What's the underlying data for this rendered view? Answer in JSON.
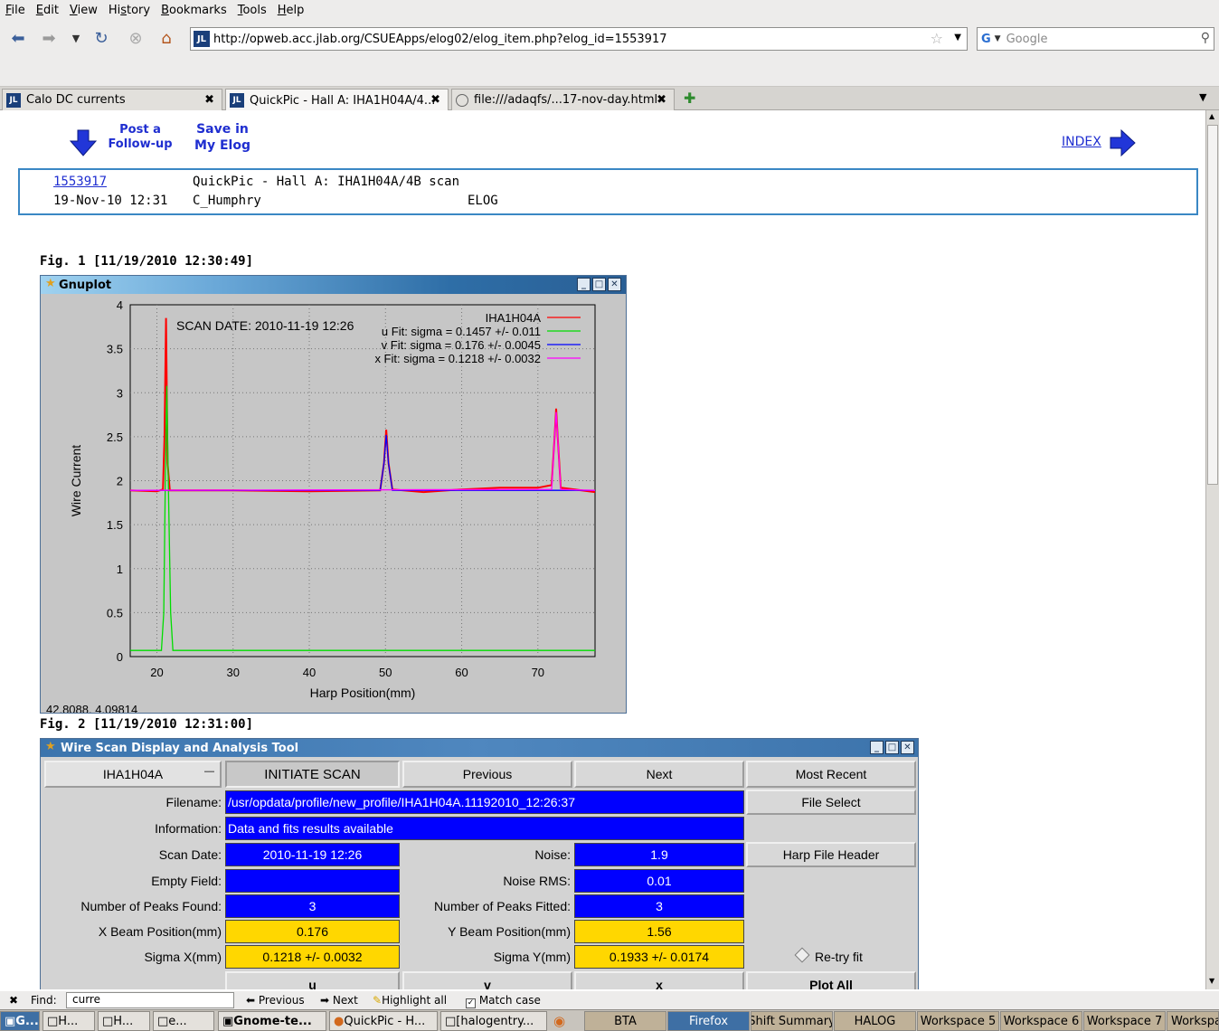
{
  "menu": {
    "items": [
      {
        "pre": "",
        "u": "F",
        "post": "ile"
      },
      {
        "pre": "",
        "u": "E",
        "post": "dit"
      },
      {
        "pre": "",
        "u": "V",
        "post": "iew"
      },
      {
        "pre": "Hi",
        "u": "s",
        "post": "tory"
      },
      {
        "pre": "",
        "u": "B",
        "post": "ookmarks"
      },
      {
        "pre": "",
        "u": "T",
        "post": "ools"
      },
      {
        "pre": "",
        "u": "H",
        "post": "elp"
      }
    ]
  },
  "nav": {
    "url": "http://opweb.acc.jlab.org/CSUEApps/elog02/elog_item.php?elog_id=1553917",
    "search_placeholder": "Google",
    "favicon": "JL"
  },
  "tabs": [
    {
      "label": "Calo DC currents",
      "icon": "JL"
    },
    {
      "label": "QuickPic - Hall A: IHA1H04A/4...",
      "icon": "JL"
    },
    {
      "label": "file:///adaqfs/...17-nov-day.html",
      "icon": "page-icon"
    }
  ],
  "page": {
    "post_followup": [
      "Post a",
      "Follow-up"
    ],
    "save_elog": [
      "Save in",
      "My Elog"
    ],
    "index_label": "INDEX",
    "entry_id": "1553917",
    "entry_title": "QuickPic - Hall A: IHA1H04A/4B scan",
    "entry_date": "19-Nov-10 12:31",
    "entry_author": "C_Humphry",
    "entry_logbook": "ELOG",
    "fig1_caption": "Fig. 1 [11/19/2010 12:30:49]",
    "fig2_caption": "Fig. 2 [11/19/2010 12:31:00]"
  },
  "gnuplot": {
    "window_title": "Gnuplot",
    "coords": "42.8088,  4.09814"
  },
  "chart_data": {
    "type": "line",
    "title": "",
    "annotation": "SCAN DATE: 2010-11-19   12:26",
    "xlabel": "Harp Position(mm)",
    "ylabel": "Wire Current",
    "xlim": [
      16.5,
      77.5
    ],
    "ylim": [
      0,
      4
    ],
    "xticks": [
      "20",
      "30",
      "40",
      "50",
      "60",
      "70"
    ],
    "yticks": [
      "0",
      "0.5",
      "1",
      "1.5",
      "2",
      "2.5",
      "3",
      "3.5",
      "4"
    ],
    "legend_position": "top-right",
    "grid": true,
    "series": [
      {
        "name": "IHA1H04A",
        "color": "#ff0000",
        "points": [
          [
            16.5,
            1.89
          ],
          [
            20,
            1.88
          ],
          [
            20.8,
            1.9
          ],
          [
            21.0,
            2.5
          ],
          [
            21.2,
            3.85
          ],
          [
            21.4,
            2.2
          ],
          [
            21.7,
            1.89
          ],
          [
            30,
            1.89
          ],
          [
            40,
            1.88
          ],
          [
            49.3,
            1.89
          ],
          [
            49.8,
            2.2
          ],
          [
            50.1,
            2.58
          ],
          [
            50.4,
            2.2
          ],
          [
            50.9,
            1.9
          ],
          [
            55,
            1.87
          ],
          [
            60,
            1.9
          ],
          [
            65,
            1.92
          ],
          [
            70,
            1.92
          ],
          [
            71.8,
            1.95
          ],
          [
            72.2,
            2.5
          ],
          [
            72.4,
            2.82
          ],
          [
            72.6,
            2.5
          ],
          [
            73,
            1.92
          ],
          [
            77.5,
            1.87
          ]
        ]
      },
      {
        "name": "u  Fit: sigma = 0.1457 +/- 0.011",
        "color": "#00dd00",
        "points": [
          [
            16.5,
            0.07
          ],
          [
            20.6,
            0.07
          ],
          [
            20.9,
            0.5
          ],
          [
            21.1,
            2.0
          ],
          [
            21.3,
            3.08
          ],
          [
            21.5,
            2.0
          ],
          [
            21.8,
            0.5
          ],
          [
            22.1,
            0.07
          ],
          [
            77.5,
            0.07
          ]
        ]
      },
      {
        "name": "v  Fit: sigma = 0.176 +/- 0.0045",
        "color": "#0000ff",
        "points": [
          [
            16.5,
            1.89
          ],
          [
            49.3,
            1.89
          ],
          [
            49.8,
            2.2
          ],
          [
            50.1,
            2.52
          ],
          [
            50.4,
            2.2
          ],
          [
            50.9,
            1.89
          ],
          [
            77.5,
            1.89
          ]
        ]
      },
      {
        "name": "x  Fit: sigma = 0.1218 +/- 0.0032",
        "color": "#ff00ff",
        "points": [
          [
            16.5,
            1.89
          ],
          [
            71.8,
            1.9
          ],
          [
            72.2,
            2.5
          ],
          [
            72.4,
            2.78
          ],
          [
            72.6,
            2.5
          ],
          [
            73,
            1.9
          ],
          [
            77.5,
            1.89
          ]
        ]
      }
    ]
  },
  "wst": {
    "window_title": "Wire Scan Display and Analysis Tool",
    "harp_select": "IHA1H04A",
    "initiate_scan": "INITIATE SCAN",
    "previous": "Previous",
    "next": "Next",
    "most_recent": "Most Recent",
    "filename_label": "Filename:",
    "filename": "/usr/opdata/profile/new_profile/IHA1H04A.11192010_12:26:37",
    "file_select": "File Select",
    "information_label": "Information:",
    "information": "Data and fits results available",
    "scan_date_label": "Scan Date:",
    "scan_date": "2010-11-19   12:26",
    "noise_label": "Noise:",
    "noise": "1.9",
    "harp_file_header": "Harp File Header",
    "empty_field_label": "Empty Field:",
    "empty_field": "",
    "noise_rms_label": "Noise RMS:",
    "noise_rms": "0.01",
    "peaks_found_label": "Number of Peaks Found:",
    "peaks_found": "3",
    "peaks_fitted_label": "Number of Peaks Fitted:",
    "peaks_fitted": "3",
    "x_beam_label": "X Beam Position(mm)",
    "x_beam": "0.176",
    "y_beam_label": "Y Beam Position(mm)",
    "y_beam": "1.56",
    "sigma_x_label": "Sigma X(mm)",
    "sigma_x": "0.1218 +/- 0.0032",
    "sigma_y_label": "Sigma Y(mm)",
    "sigma_y": "0.1933 +/- 0.0174",
    "retry_fit": "Re-try fit",
    "btn_u": "u",
    "btn_v": "v",
    "btn_x": "x",
    "plot_all": "Plot All"
  },
  "findbar": {
    "find_label": "Find:",
    "find_value": "curre",
    "previous": "Previous",
    "next": "Next",
    "highlight": "Highlight all",
    "match_case": "Match case"
  },
  "taskbar": {
    "items": [
      "G...",
      "H...",
      "H...",
      "e...",
      "Gnome-te...",
      "QuickPic - H...",
      "[halogentry..."
    ],
    "workspaces": [
      "BTA",
      "Firefox",
      "Shift Summary",
      "HALOG",
      "Workspace 5",
      "Workspace 6",
      "Workspace 7",
      "Workspa"
    ]
  }
}
